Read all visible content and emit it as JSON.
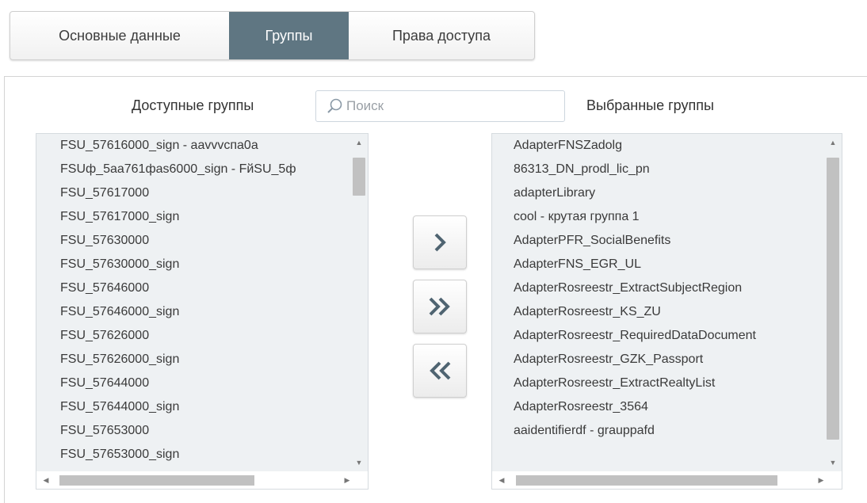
{
  "tabs": [
    {
      "label": "Основные данные",
      "active": false
    },
    {
      "label": "Группы",
      "active": true
    },
    {
      "label": "Права доступа",
      "active": false
    }
  ],
  "colors": {
    "active_tab": "#5f7682",
    "list_bg": "#eef1f3",
    "arrow": "#4f6471"
  },
  "available": {
    "label": "Доступные группы",
    "items": [
      "FSU_57616000_sign - aavvvcпa0a",
      "FSUф_5aa761фas6000_sign - FйSU_5ф",
      "FSU_57617000",
      "FSU_57617000_sign",
      "FSU_57630000",
      "FSU_57630000_sign",
      "FSU_57646000",
      "FSU_57646000_sign",
      "FSU_57626000",
      "FSU_57626000_sign",
      "FSU_57644000",
      "FSU_57644000_sign",
      "FSU_57653000",
      "FSU_57653000_sign"
    ]
  },
  "search": {
    "placeholder": "Поиск",
    "icon": "search-icon"
  },
  "selected": {
    "label": "Выбранные группы",
    "items": [
      "AdapterFNSZadolg",
      "86313_DN_prodl_lic_pn",
      "adapterLibrary",
      "cool - крутая группа 1",
      "AdapterPFR_SocialBenefits",
      "AdapterFNS_EGR_UL",
      "AdapterRosreestr_ExtractSubjectRegion",
      "AdapterRosreestr_KS_ZU",
      "AdapterRosreestr_RequiredDataDocument",
      "AdapterRosreestr_GZK_Passport",
      "AdapterRosreestr_ExtractRealtyList",
      "AdapterRosreestr_3564",
      "aaidentifierdf - grauppafd"
    ]
  },
  "buttons": {
    "add": "chevron-right-icon",
    "add_all": "double-chevron-right-icon",
    "remove_all": "double-chevron-left-icon"
  }
}
